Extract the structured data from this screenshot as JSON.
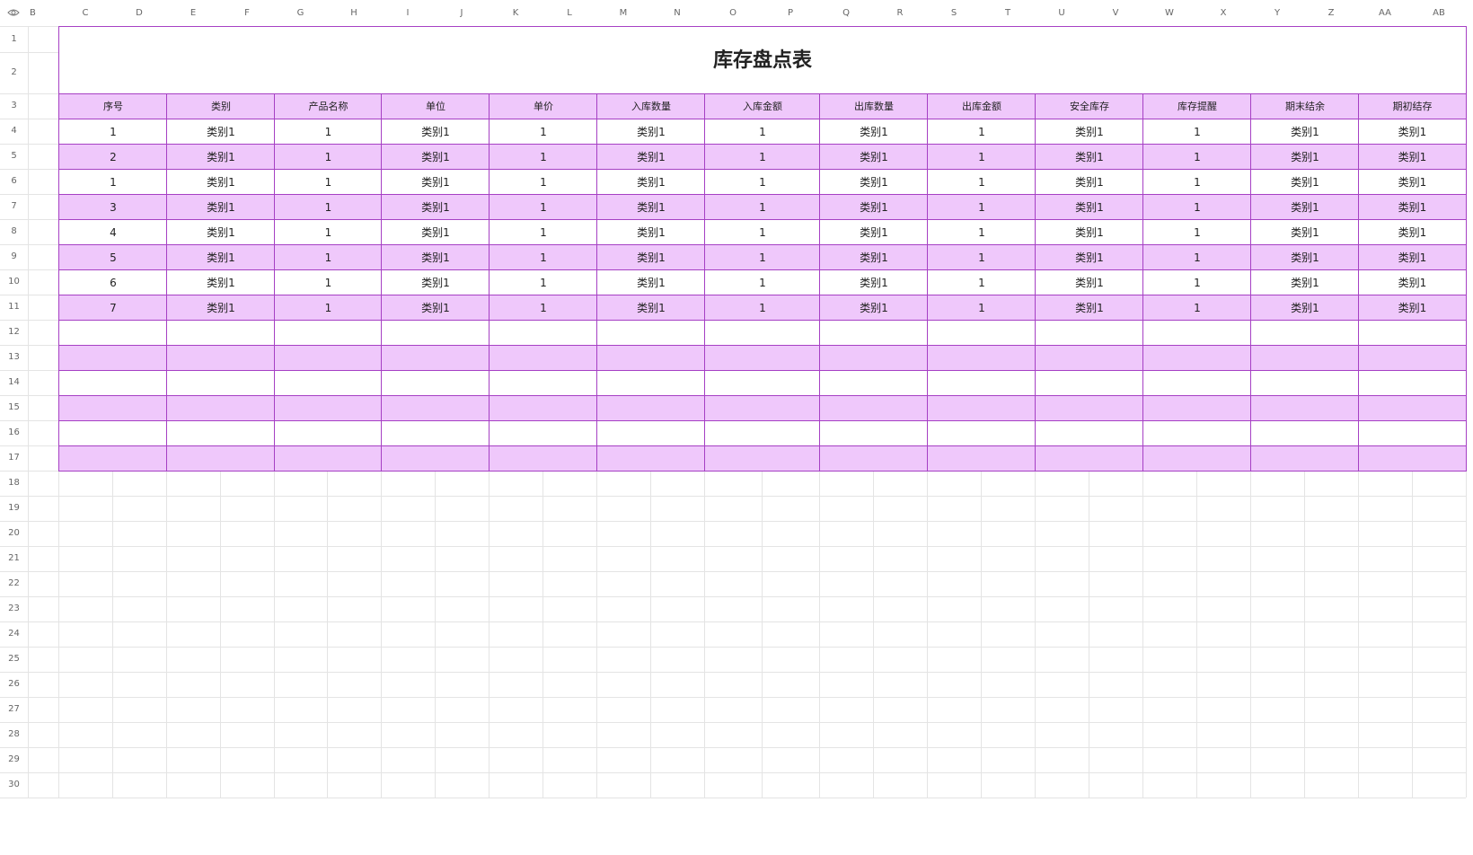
{
  "sheet": {
    "column_letters": [
      "B",
      "C",
      "D",
      "E",
      "F",
      "G",
      "H",
      "I",
      "J",
      "K",
      "L",
      "M",
      "N",
      "O",
      "P",
      "Q",
      "R",
      "S",
      "T",
      "U",
      "V",
      "W",
      "X",
      "Y",
      "Z",
      "AA",
      "AB"
    ],
    "row_numbers": [
      "1",
      "2",
      "3",
      "4",
      "5",
      "6",
      "7",
      "8",
      "9",
      "10",
      "11",
      "12",
      "13",
      "14",
      "15",
      "16",
      "17",
      "18",
      "19",
      "20",
      "21",
      "22",
      "23",
      "24",
      "25",
      "26",
      "27",
      "28",
      "29",
      "30"
    ],
    "corner_icon": "eye-icon"
  },
  "table": {
    "title": "库存盘点表",
    "headers": [
      "序号",
      "类别",
      "产品名称",
      "单位",
      "单价",
      "入库数量",
      "入库金额",
      "出库数量",
      "出库金额",
      "安全库存",
      "库存提醒",
      "期末结余",
      "期初结存"
    ],
    "rows": [
      [
        "1",
        "类别1",
        "1",
        "类别1",
        "1",
        "类别1",
        "1",
        "类别1",
        "1",
        "类别1",
        "1",
        "类别1",
        "类别1"
      ],
      [
        "2",
        "类别1",
        "1",
        "类别1",
        "1",
        "类别1",
        "1",
        "类别1",
        "1",
        "类别1",
        "1",
        "类别1",
        "类别1"
      ],
      [
        "1",
        "类别1",
        "1",
        "类别1",
        "1",
        "类别1",
        "1",
        "类别1",
        "1",
        "类别1",
        "1",
        "类别1",
        "类别1"
      ],
      [
        "3",
        "类别1",
        "1",
        "类别1",
        "1",
        "类别1",
        "1",
        "类别1",
        "1",
        "类别1",
        "1",
        "类别1",
        "类别1"
      ],
      [
        "4",
        "类别1",
        "1",
        "类别1",
        "1",
        "类别1",
        "1",
        "类别1",
        "1",
        "类别1",
        "1",
        "类别1",
        "类别1"
      ],
      [
        "5",
        "类别1",
        "1",
        "类别1",
        "1",
        "类别1",
        "1",
        "类别1",
        "1",
        "类别1",
        "1",
        "类别1",
        "类别1"
      ],
      [
        "6",
        "类别1",
        "1",
        "类别1",
        "1",
        "类别1",
        "1",
        "类别1",
        "1",
        "类别1",
        "1",
        "类别1",
        "类别1"
      ],
      [
        "7",
        "类别1",
        "1",
        "类别1",
        "1",
        "类别1",
        "1",
        "类别1",
        "1",
        "类别1",
        "1",
        "类别1",
        "类别1"
      ],
      [
        "",
        "",
        "",
        "",
        "",
        "",
        "",
        "",
        "",
        "",
        "",
        "",
        ""
      ],
      [
        "",
        "",
        "",
        "",
        "",
        "",
        "",
        "",
        "",
        "",
        "",
        "",
        ""
      ],
      [
        "",
        "",
        "",
        "",
        "",
        "",
        "",
        "",
        "",
        "",
        "",
        "",
        ""
      ],
      [
        "",
        "",
        "",
        "",
        "",
        "",
        "",
        "",
        "",
        "",
        "",
        "",
        ""
      ],
      [
        "",
        "",
        "",
        "",
        "",
        "",
        "",
        "",
        "",
        "",
        "",
        "",
        ""
      ],
      [
        "",
        "",
        "",
        "",
        "",
        "",
        "",
        "",
        "",
        "",
        "",
        "",
        ""
      ]
    ]
  },
  "colors": {
    "border": "#a640c4",
    "band": "#efc8fb",
    "grid": "#e4e4e4"
  }
}
